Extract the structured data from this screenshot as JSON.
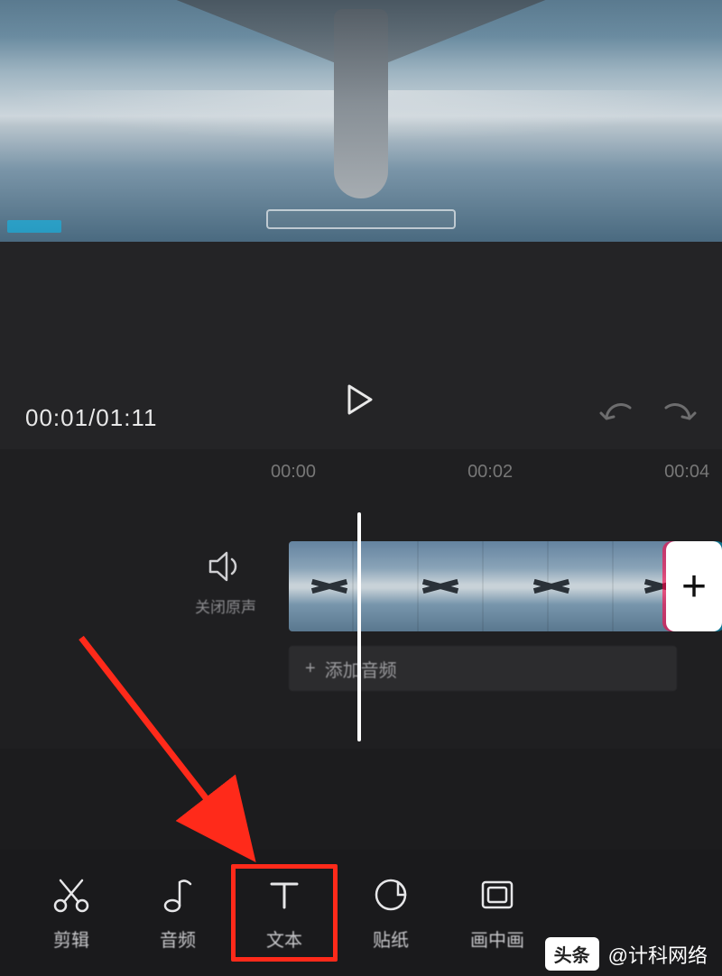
{
  "playback": {
    "time_label": "00:01/01:11"
  },
  "ruler": {
    "t0": "00:00",
    "t1": "00:02",
    "t2": "00:04"
  },
  "mute": {
    "label": "关闭原声"
  },
  "audio_track": {
    "plus": "+",
    "label": "添加音频"
  },
  "add_clip": {
    "plus": "+"
  },
  "toolbar": {
    "cut": "剪辑",
    "audio": "音频",
    "text": "文本",
    "sticker": "贴纸",
    "pip": "画中画"
  },
  "watermark": {
    "badge": "头条",
    "text": "@计科网络"
  }
}
